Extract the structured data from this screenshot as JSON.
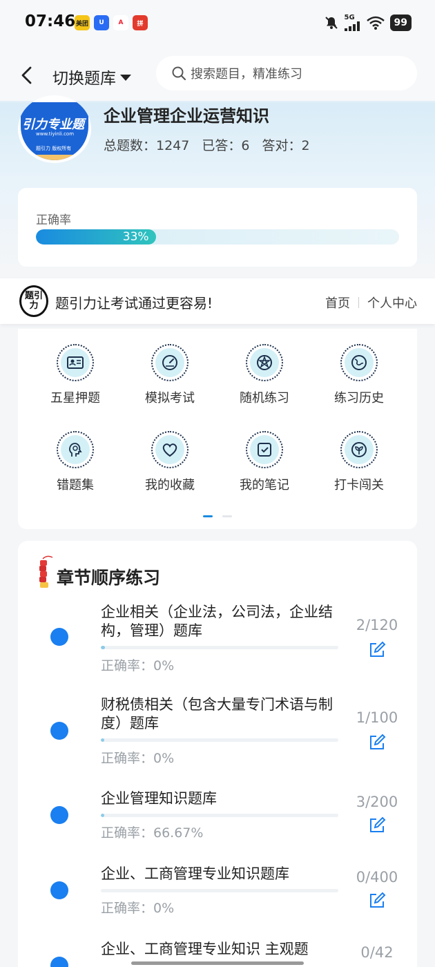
{
  "status_bar": {
    "time": "07:46",
    "apps": [
      "美团",
      "U",
      "A",
      "拼"
    ],
    "network": "5G",
    "battery": "99"
  },
  "header": {
    "switch_label": "切换题库",
    "search_placeholder": "搜索题目，精准练习"
  },
  "subject": {
    "logo_title": "引力专业题",
    "logo_url": "www.tiyinli.com",
    "logo_copy": "题引力 版权所有",
    "title": "企业管理企业运营知识",
    "total_label": "总题数：1247",
    "answered_label": "已答：6",
    "correct_label": "答对：2"
  },
  "accuracy": {
    "label": "正确率",
    "percent_text": "33%",
    "fraction": 0.33
  },
  "banner": {
    "logo_text": "题引力",
    "slogan": "题引力让考试通过更容易!",
    "home_link": "首页",
    "profile_link": "个人中心"
  },
  "menu": {
    "items": [
      {
        "label": "五星押题",
        "icon": "id-card-icon"
      },
      {
        "label": "模拟考试",
        "icon": "gauge-icon"
      },
      {
        "label": "随机练习",
        "icon": "network-icon"
      },
      {
        "label": "练习历史",
        "icon": "globe-icon"
      },
      {
        "label": "错题集",
        "icon": "head-icon"
      },
      {
        "label": "我的收藏",
        "icon": "heart-icon"
      },
      {
        "label": "我的笔记",
        "icon": "note-check-icon"
      },
      {
        "label": "打卡闯关",
        "icon": "sprout-icon"
      }
    ]
  },
  "chapters": {
    "title": "章节顺序练习",
    "items": [
      {
        "name": "企业相关（企业法，公司法，企业结构，管理）题库",
        "accuracy": "正确率：0%",
        "count": "2/120",
        "progress": 0.0167
      },
      {
        "name": "财税债相关（包含大量专门术语与制度）题库",
        "accuracy": "正确率：0%",
        "count": "1/100",
        "progress": 0.01
      },
      {
        "name": "企业管理知识题库",
        "accuracy": "正确率：66.67%",
        "count": "3/200",
        "progress": 0.015
      },
      {
        "name": "企业、工商管理专业知识题库",
        "accuracy": "正确率：0%",
        "count": "0/400",
        "progress": 0
      },
      {
        "name": "企业、工商管理专业知识 主观题",
        "accuracy": "",
        "count": "0/42",
        "progress": 0
      }
    ]
  },
  "colors": {
    "accent": "#1a8be0",
    "dot_blue": "#1a7ff0",
    "progress_end": "#30c4bd"
  }
}
